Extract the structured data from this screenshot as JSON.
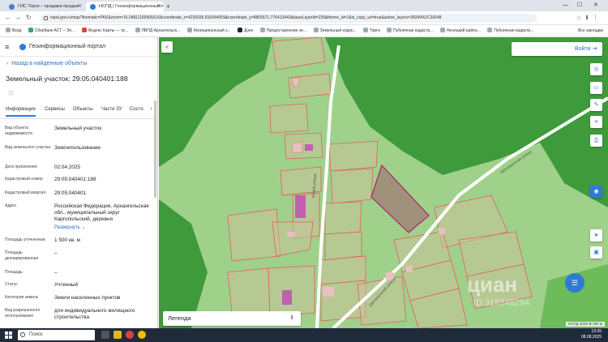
{
  "browser": {
    "tabs": [
      {
        "label": "ГИС Торги – продажи продаж"
      },
      {
        "label": "НСПД | Геоинформационный п"
      }
    ],
    "new_tab": "+",
    "url": "nspd.gov.ru/map?thematic=PKK&zoom=16.04811160905616&coordinate_x=4235936.810044059&coordinate_y=8805671.776413443&baseLayerId=235&theme_id=1&is_copy_url=true&active_layers=36049%2C36048",
    "bookmarks": [
      "Вход",
      "Сбербанк АСТ – Эл...",
      "Яндекс Карты — тр...",
      "ЛВПД Архангельск...",
      "Муниципальный з...",
      "Дзен",
      "Предоставление зе...",
      "Земельный кодек...",
      "Торги",
      "Публичная кадастр...",
      "Ненецкий район...",
      "Публичная кадастр..."
    ],
    "bookmarks_all": "Все закладки",
    "window_controls": [
      "—",
      "☐",
      "✕"
    ]
  },
  "panel": {
    "portal_title": "Геоинформационный портал",
    "back_link": "Назад в найденные объекты",
    "object_title": "Земельный участок: 29:05:040401:188",
    "tabs": [
      "Информация",
      "Сервисы",
      "Объекты",
      "Части ЗУ",
      "Состо"
    ],
    "fields": [
      {
        "key": "Вид объекта недвижимости",
        "value": "Земельный участок"
      },
      {
        "key": "Вид земельного участка",
        "value": "Землепользование"
      },
      {
        "key": "Дата присвоения",
        "value": "02.04.2025"
      },
      {
        "key": "Кадастровый номер",
        "value": "29:05:040401:188"
      },
      {
        "key": "Кадастровый квартал",
        "value": "29:05:040401"
      },
      {
        "key": "Адрес",
        "value": "Российская Федерация, Архангельская обл., муниципальный округ Каргопольский, деревня"
      },
      {
        "key": "Площадь уточненная",
        "value": "1 500 кв. м"
      },
      {
        "key": "Площадь декларированная",
        "value": "–"
      },
      {
        "key": "Площадь",
        "value": "–"
      },
      {
        "key": "Статус",
        "value": "Учтенный"
      },
      {
        "key": "Категория земель",
        "value": "Земли населенных пунктов"
      },
      {
        "key": "Вид разрешенного использования",
        "value": "для индивидуального жилищного строительства"
      }
    ],
    "expand_label": "Развернуть ⌄"
  },
  "map": {
    "login_label": "Войти",
    "legend_label": "Легенда",
    "road_label_1": "Новая улица",
    "road_label_2": "Центральная улица",
    "road_label_3": "Центральная улица",
    "watermark": "циан",
    "watermark_id": "ID 319248294",
    "scale_text": "НСПД 2025 ⊕    200 м",
    "colors": {
      "forest": "#3f9a3c",
      "meadow": "#9fd18a",
      "selected_parcel": "#a08a7a",
      "parcel_border": "#e06060"
    }
  },
  "taskbar": {
    "search_placeholder": "Поиск",
    "time": "13:35",
    "date": "08.08.2025"
  }
}
